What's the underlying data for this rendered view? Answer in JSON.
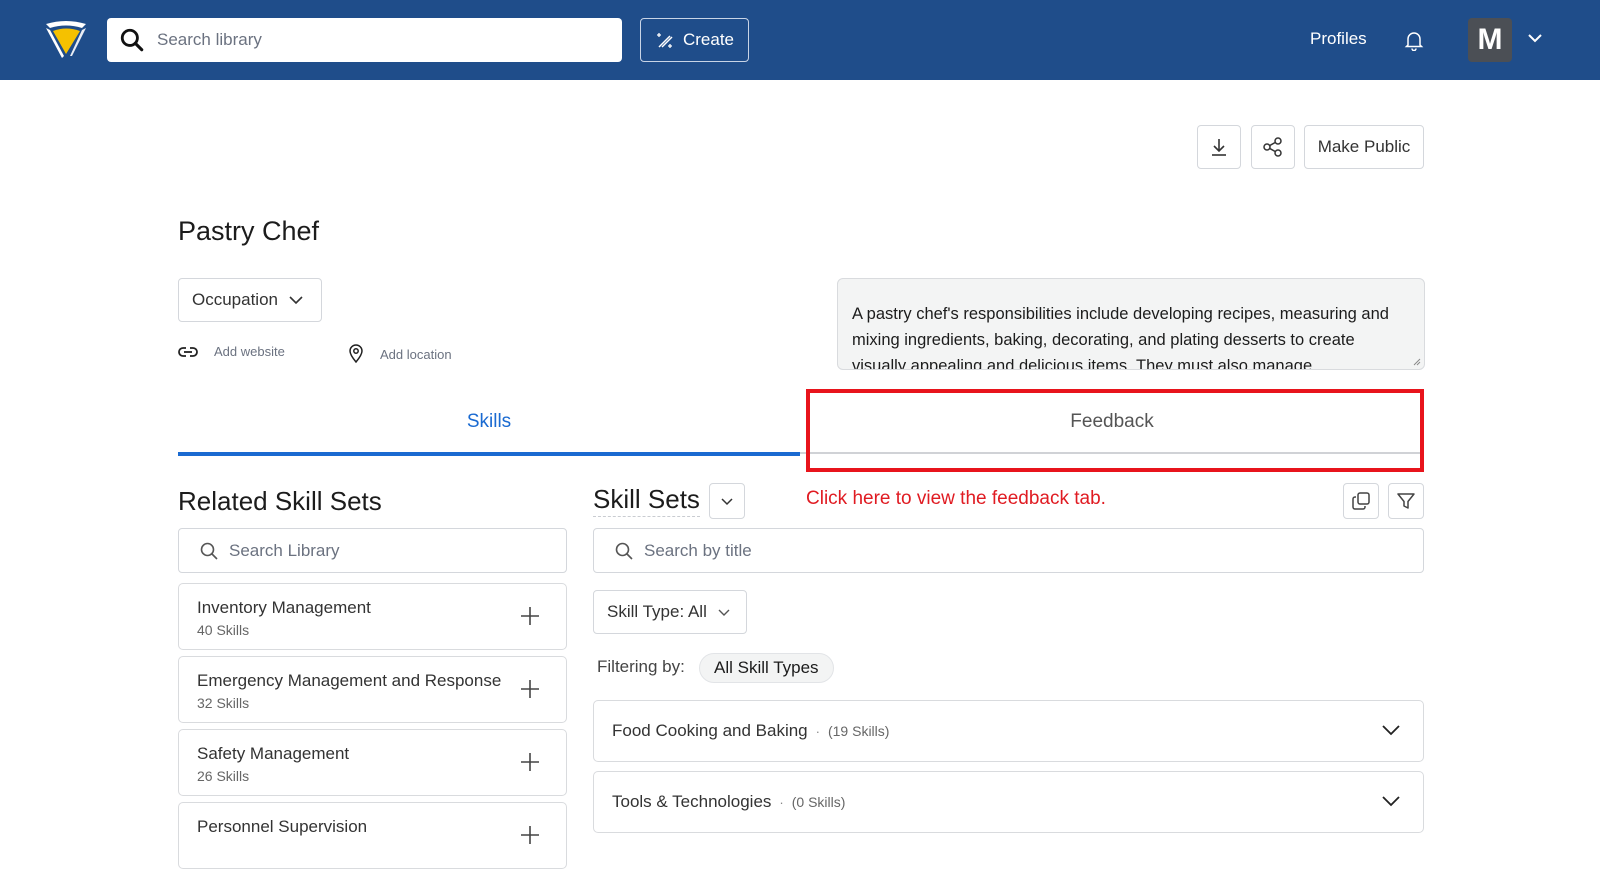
{
  "header": {
    "search_placeholder": "Search library",
    "create_label": "Create",
    "profiles_label": "Profiles",
    "avatar_initial": "M",
    "brand_color": "#1f4d8a",
    "logo_accent": "#f5c100"
  },
  "actions": {
    "download_label": "Download",
    "share_label": "Share",
    "make_public_label": "Make Public"
  },
  "profile": {
    "title": "Pastry Chef",
    "type_select": "Occupation",
    "add_website_label": "Add website",
    "add_location_label": "Add location",
    "description": "A pastry chef's responsibilities include developing recipes, measuring and mixing ingredients, baking, decorating, and plating desserts to create visually appealing and delicious items. They must also manage"
  },
  "tabs": [
    {
      "label": "Skills",
      "active": true
    },
    {
      "label": "Feedback",
      "active": false
    }
  ],
  "annotation": {
    "text": "Click here to view the feedback tab.",
    "color": "#e8141c"
  },
  "related": {
    "title": "Related Skill Sets",
    "search_placeholder": "Search Library",
    "items": [
      {
        "name": "Inventory Management",
        "count": "40 Skills"
      },
      {
        "name": "Emergency Management and Response",
        "count": "32 Skills"
      },
      {
        "name": "Safety Management",
        "count": "26 Skills"
      },
      {
        "name": "Personnel Supervision",
        "count": ""
      }
    ]
  },
  "skill_sets": {
    "title": "Skill Sets",
    "search_placeholder": "Search by title",
    "skill_type_select": "Skill Type: All",
    "filtering_label": "Filtering by:",
    "filter_chip": "All Skill Types",
    "groups": [
      {
        "name": "Food Cooking and Baking",
        "count": "(19 Skills)"
      },
      {
        "name": "Tools & Technologies",
        "count": "(0 Skills)"
      }
    ]
  }
}
